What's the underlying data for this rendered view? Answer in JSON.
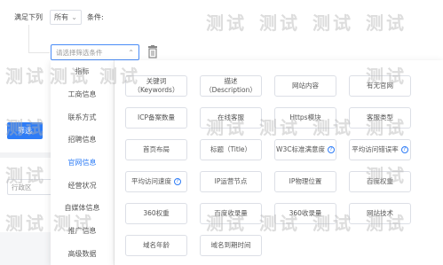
{
  "filter": {
    "label_prefix": "满足下列",
    "match_value": "所有",
    "label_suffix": "条件:",
    "condition_placeholder": "请选择筛选条件",
    "filter_button": "筛选",
    "bottom_select": "行政区"
  },
  "categories": [
    {
      "label": "指标",
      "active": false
    },
    {
      "label": "工商信息",
      "active": false
    },
    {
      "label": "联系方式",
      "active": false
    },
    {
      "label": "招聘信息",
      "active": false
    },
    {
      "label": "官网信息",
      "active": true
    },
    {
      "label": "经营状况",
      "active": false
    },
    {
      "label": "自媒体信息",
      "active": false
    },
    {
      "label": "推广信息",
      "active": false
    },
    {
      "label": "高级数据",
      "active": false
    }
  ],
  "options": [
    {
      "line1": "关键词",
      "line2": "（Keywords）",
      "help": false
    },
    {
      "line1": "描述",
      "line2": "（Description）",
      "help": false
    },
    {
      "line1": "网站内容",
      "line2": "",
      "help": false
    },
    {
      "line1": "有无官网",
      "line2": "",
      "help": false
    },
    {
      "line1": "ICP备案数量",
      "line2": "",
      "help": false
    },
    {
      "line1": "在线客服",
      "line2": "",
      "help": false
    },
    {
      "line1": "Https模块",
      "line2": "",
      "help": false
    },
    {
      "line1": "客服类型",
      "line2": "",
      "help": false
    },
    {
      "line1": "首页布局",
      "line2": "",
      "help": false
    },
    {
      "line1": "标题（Title）",
      "line2": "",
      "help": false
    },
    {
      "line1": "W3C标准满意度",
      "line2": "",
      "help": true
    },
    {
      "line1": "平均访问错误率",
      "line2": "",
      "help": true
    },
    {
      "line1": "平均访问速度",
      "line2": "",
      "help": true
    },
    {
      "line1": "IP运营节点",
      "line2": "",
      "help": false
    },
    {
      "line1": "IP物理位置",
      "line2": "",
      "help": false
    },
    {
      "line1": "百度权重",
      "line2": "",
      "help": false
    },
    {
      "line1": "360权重",
      "line2": "",
      "help": false
    },
    {
      "line1": "百度收录量",
      "line2": "",
      "help": false
    },
    {
      "line1": "360收录量",
      "line2": "",
      "help": false
    },
    {
      "line1": "网站技术",
      "line2": "",
      "help": false
    },
    {
      "line1": "域名年龄",
      "line2": "",
      "help": false
    },
    {
      "line1": "域名到期时间",
      "line2": "",
      "help": false
    }
  ],
  "watermark": "测试",
  "colors": {
    "primary": "#2e7cf6",
    "border": "#dcdfe6",
    "text": "#555555"
  },
  "icons": {
    "dropdown": "chevron-down-icon",
    "delete": "trash-icon",
    "help": "question-circle-icon"
  }
}
